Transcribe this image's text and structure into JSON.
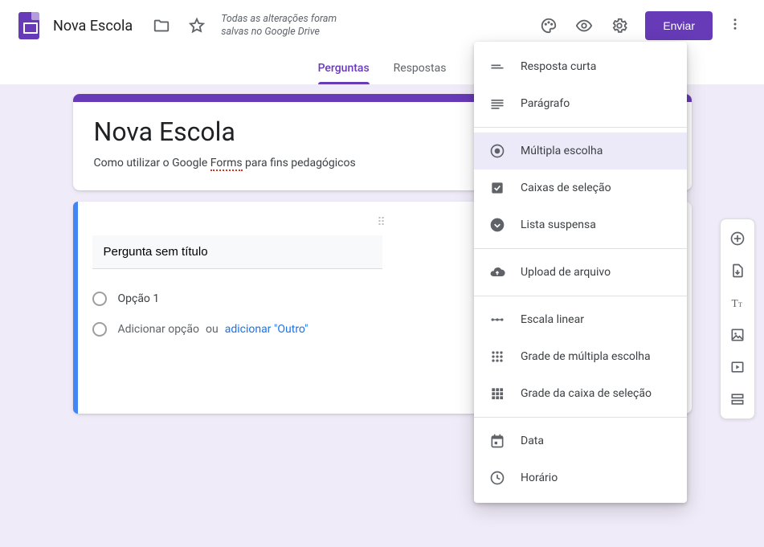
{
  "header": {
    "doc_title": "Nova Escola",
    "save_message": "Todas as alterações foram salvas no Google Drive",
    "send_label": "Enviar"
  },
  "tabs": {
    "questions": "Perguntas",
    "responses": "Respostas"
  },
  "form": {
    "title": "Nova Escola",
    "desc_prefix": "Como utilizar o Google ",
    "desc_forms": "Forms",
    "desc_suffix": " para fins pedagógicos"
  },
  "question": {
    "input_value": "Pergunta sem título",
    "option1": "Opção 1",
    "add_option": "Adicionar opção",
    "or": "ou",
    "add_other": "adicionar \"Outro\""
  },
  "dropdown": {
    "short_answer": "Resposta curta",
    "paragraph": "Parágrafo",
    "multiple_choice": "Múltipla escolha",
    "checkboxes": "Caixas de seleção",
    "dropdown": "Lista suspensa",
    "file_upload": "Upload de arquivo",
    "linear_scale": "Escala linear",
    "mc_grid": "Grade de múltipla escolha",
    "cb_grid": "Grade da caixa de seleção",
    "date": "Data",
    "time": "Horário"
  },
  "colors": {
    "primary": "#673ab7",
    "accent_blue": "#4285f4",
    "canvas_bg": "#f0ebf8"
  }
}
